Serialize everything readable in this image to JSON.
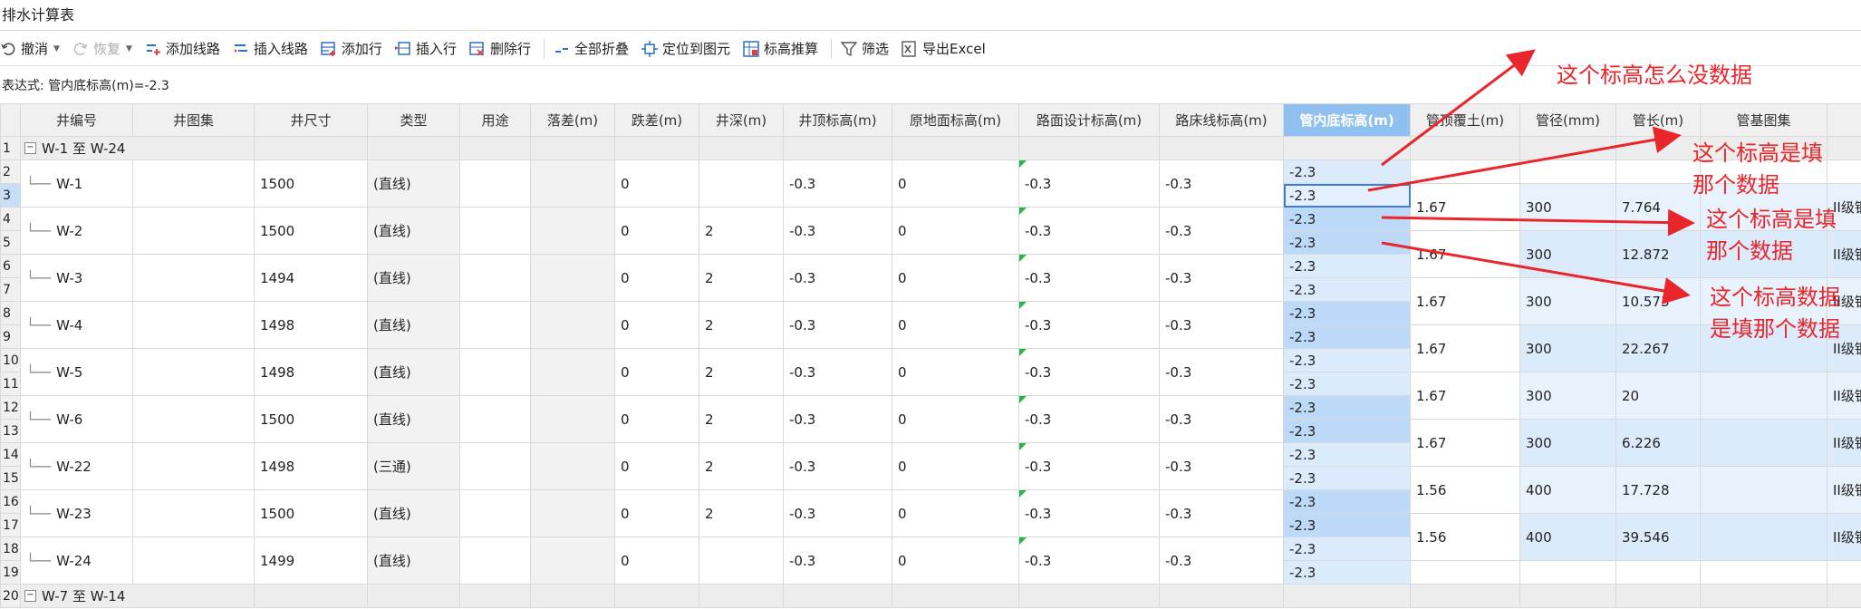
{
  "window_title": "排水计算表",
  "toolbar": [
    {
      "id": "undo",
      "label": "撤消",
      "icon": "undo-icon",
      "caret": true,
      "disabled": false
    },
    {
      "id": "redo",
      "label": "恢复",
      "icon": "redo-icon",
      "caret": true,
      "disabled": true
    },
    {
      "id": "add-line",
      "label": "添加线路",
      "icon": "add-line-icon",
      "disabled": false
    },
    {
      "id": "insert-line",
      "label": "插入线路",
      "icon": "insert-line-icon",
      "disabled": false
    },
    {
      "id": "add-row",
      "label": "添加行",
      "icon": "add-row-icon",
      "disabled": false
    },
    {
      "id": "insert-row",
      "label": "插入行",
      "icon": "insert-row-icon",
      "disabled": false
    },
    {
      "id": "delete-row",
      "label": "删除行",
      "icon": "delete-row-icon",
      "disabled": false,
      "sep_after": true
    },
    {
      "id": "collapse-all",
      "label": "全部折叠",
      "icon": "collapse-icon",
      "disabled": false
    },
    {
      "id": "locate",
      "label": "定位到图元",
      "icon": "locate-icon",
      "disabled": false
    },
    {
      "id": "elevation",
      "label": "标高推算",
      "icon": "elevation-icon",
      "disabled": false,
      "sep_after": true
    },
    {
      "id": "filter",
      "label": "筛选",
      "icon": "filter-icon",
      "disabled": false
    },
    {
      "id": "export",
      "label": "导出Excel",
      "icon": "export-excel-icon",
      "disabled": false
    }
  ],
  "expression": "表达式:  管内底标高(m)=-2.3",
  "columns": [
    "井编号",
    "井图集",
    "井尺寸",
    "类型",
    "用途",
    "落差(m)",
    "跌差(m)",
    "井深(m)",
    "井顶标高(m)",
    "原地面标高(m)",
    "路面设计标高(m)",
    "路床线标高(m)",
    "管内底标高(m)",
    "管顶覆土(m)",
    "管径(mm)",
    "管长(m)",
    "管基图集",
    ""
  ],
  "highlight_column": "管内底标高(m)",
  "group1_label": "W-1 至 W-24",
  "group2_label": "W-7 至 W-14",
  "wells": [
    {
      "id": "W-1",
      "size": "1500",
      "type": "(直线)",
      "jump": "0",
      "depth": "",
      "top": "-0.3",
      "ground": "0",
      "road": "-0.3",
      "bed": "-0.3"
    },
    {
      "id": "W-2",
      "size": "1500",
      "type": "(直线)",
      "jump": "0",
      "depth": "2",
      "top": "-0.3",
      "ground": "0",
      "road": "-0.3",
      "bed": "-0.3"
    },
    {
      "id": "W-3",
      "size": "1494",
      "type": "(直线)",
      "jump": "0",
      "depth": "2",
      "top": "-0.3",
      "ground": "0",
      "road": "-0.3",
      "bed": "-0.3"
    },
    {
      "id": "W-4",
      "size": "1498",
      "type": "(直线)",
      "jump": "0",
      "depth": "2",
      "top": "-0.3",
      "ground": "0",
      "road": "-0.3",
      "bed": "-0.3"
    },
    {
      "id": "W-5",
      "size": "1498",
      "type": "(直线)",
      "jump": "0",
      "depth": "2",
      "top": "-0.3",
      "ground": "0",
      "road": "-0.3",
      "bed": "-0.3"
    },
    {
      "id": "W-6",
      "size": "1500",
      "type": "(直线)",
      "jump": "0",
      "depth": "2",
      "top": "-0.3",
      "ground": "0",
      "road": "-0.3",
      "bed": "-0.3"
    },
    {
      "id": "W-22",
      "size": "1498",
      "type": "(三通)",
      "jump": "0",
      "depth": "2",
      "top": "-0.3",
      "ground": "0",
      "road": "-0.3",
      "bed": "-0.3"
    },
    {
      "id": "W-23",
      "size": "1500",
      "type": "(直线)",
      "jump": "0",
      "depth": "2",
      "top": "-0.3",
      "ground": "0",
      "road": "-0.3",
      "bed": "-0.3"
    },
    {
      "id": "W-24",
      "size": "1499",
      "type": "(直线)",
      "jump": "0",
      "depth": "",
      "top": "-0.3",
      "ground": "0",
      "road": "-0.3",
      "bed": "-0.3"
    }
  ],
  "pipes": [
    {
      "cover": "1.67",
      "dia": "300",
      "len": "7.764",
      "base": "II级钢筋"
    },
    {
      "cover": "1.67",
      "dia": "300",
      "len": "12.872",
      "base": "II级钢筋"
    },
    {
      "cover": "1.67",
      "dia": "300",
      "len": "10.573",
      "base": "II级钢筋"
    },
    {
      "cover": "1.67",
      "dia": "300",
      "len": "22.267",
      "base": "II级钢筋"
    },
    {
      "cover": "1.67",
      "dia": "300",
      "len": "20",
      "base": "II级钢筋"
    },
    {
      "cover": "1.67",
      "dia": "300",
      "len": "6.226",
      "base": "II级钢筋"
    },
    {
      "cover": "1.56",
      "dia": "400",
      "len": "17.728",
      "base": "II级钢筋"
    },
    {
      "cover": "1.56",
      "dia": "400",
      "len": "39.546",
      "base": "II级钢筋"
    }
  ],
  "invert_value": "-2.3",
  "row_numbers": [
    "1",
    "2",
    "3",
    "4",
    "5",
    "6",
    "7",
    "8",
    "9",
    "10",
    "11",
    "12",
    "13",
    "14",
    "15",
    "16",
    "17",
    "18",
    "19",
    "20"
  ],
  "annotations": [
    {
      "text": "这个标高怎么没数据"
    },
    {
      "text": "这个标高是填\n那个数据"
    },
    {
      "text": "这个标高是填\n那个数据"
    },
    {
      "text": "这个标高数据\n是填那个数据"
    }
  ],
  "colors": {
    "annotation": "#e8262b",
    "header_highlight": "#8fc0ef",
    "selection": "#3b7fd9"
  }
}
